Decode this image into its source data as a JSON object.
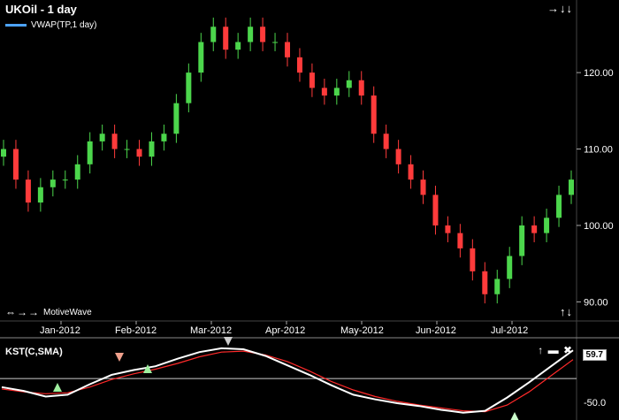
{
  "chart": {
    "title": "UKOil - 1 day",
    "legend_label": "VWAP(TP,1 day)",
    "brand": "MotiveWave",
    "price_ticks": [
      "120.00",
      "110.00",
      "100.00",
      "90.00"
    ],
    "kst_title": "KST(C,SMA)",
    "kst_ticks": [
      "-50.0"
    ],
    "kst_value": "59.7",
    "months": [
      "Jan-2012",
      "Feb-2012",
      "Mar-2012",
      "Apr-2012",
      "May-2012",
      "Jun-2012",
      "Jul-2012"
    ]
  },
  "colors": {
    "background": "#000000",
    "up_candle": "#4cd64c",
    "down_candle": "#ff3b3b",
    "kst_line": "#ffffff",
    "signal_line": "#ff2a2a",
    "vwap_legend": "#4da3ff"
  },
  "chart_data": [
    {
      "type": "line",
      "title": "UKOil - 1 day",
      "ylim": [
        87.5,
        129.5
      ],
      "y_ticks": [
        90,
        100,
        110,
        120
      ],
      "categories": [
        "Jan-2012",
        "Feb-2012",
        "Mar-2012",
        "Apr-2012",
        "May-2012",
        "Jun-2012",
        "Jul-2012"
      ],
      "series": [
        {
          "name": "UKOil",
          "values": [
            110,
            106,
            103,
            105,
            106,
            106,
            108,
            111,
            112,
            110,
            110,
            109,
            111,
            112,
            116,
            120,
            124,
            126,
            123,
            124,
            126,
            124,
            124,
            122,
            120,
            118,
            117,
            118,
            119,
            117,
            112,
            110,
            108,
            106,
            104,
            100,
            99,
            97,
            94,
            91,
            93,
            96,
            100,
            99,
            101,
            104,
            106
          ]
        }
      ]
    },
    {
      "type": "line",
      "title": "KST(C,SMA)",
      "ylim": [
        -80,
        75
      ],
      "y_ticks": [
        -50
      ],
      "series": [
        {
          "name": "KST(C,SMA)",
          "values": [
            -18,
            -26,
            -38,
            -34,
            -12,
            8,
            18,
            26,
            42,
            56,
            64,
            62,
            48,
            28,
            8,
            -14,
            -34,
            -44,
            -52,
            -58,
            -66,
            -72,
            -68,
            -40,
            -8,
            26,
            59.7
          ]
        },
        {
          "name": "SMA",
          "values": [
            -22,
            -28,
            -32,
            -30,
            -18,
            -2,
            10,
            20,
            32,
            46,
            56,
            58,
            50,
            36,
            16,
            -6,
            -24,
            -38,
            -48,
            -56,
            -62,
            -68,
            -70,
            -56,
            -28,
            6,
            40
          ]
        }
      ]
    }
  ]
}
